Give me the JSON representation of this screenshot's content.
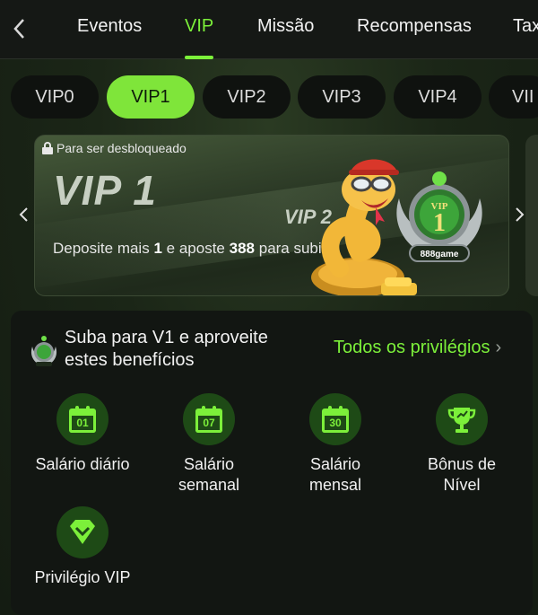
{
  "nav": {
    "back_icon": "chevron-left-icon",
    "tabs": [
      {
        "label": "Eventos"
      },
      {
        "label": "VIP"
      },
      {
        "label": "Missão"
      },
      {
        "label": "Recompensas"
      },
      {
        "label": "Tax"
      }
    ],
    "active_tab": "VIP"
  },
  "levels": [
    "VIP0",
    "VIP1",
    "VIP2",
    "VIP3",
    "VIP4",
    "VII"
  ],
  "active_level": "VIP1",
  "banner": {
    "lock_label": "Para ser desbloqueado",
    "current_level": "VIP 1",
    "next_level": "VIP 2",
    "deposit_prefix": "Deposite mais",
    "deposit_amount": "1",
    "deposit_middle": "e aposte",
    "bet_amount": "388",
    "deposit_suffix": "para subir",
    "badge_text": "888game",
    "badge_vip": "VIP",
    "badge_num": "1"
  },
  "privileges": {
    "title": "Suba para V1 e aproveite estes benefícios",
    "link_label": "Todos os privilégios",
    "link_chevron": "›",
    "benefits": [
      {
        "label": "Salário diário",
        "day": "01",
        "icon": "calendar-icon"
      },
      {
        "label": "Salário semanal",
        "day": "07",
        "icon": "calendar-icon"
      },
      {
        "label": "Salário mensal",
        "day": "30",
        "icon": "calendar-icon"
      },
      {
        "label": "Bônus de Nível",
        "icon": "trophy-icon"
      },
      {
        "label": "Privilégio VIP",
        "icon": "diamond-icon"
      }
    ]
  },
  "colors": {
    "accent": "#7cf03a",
    "icon_bg": "#1e4a16",
    "card_bg": "#121612"
  }
}
